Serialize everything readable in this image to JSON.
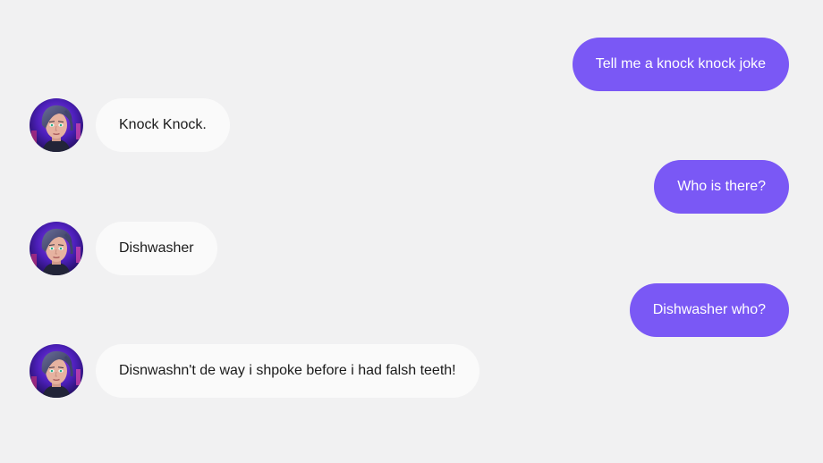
{
  "chat": {
    "messages": [
      {
        "sender": "user",
        "text": "Tell me a knock knock joke"
      },
      {
        "sender": "bot",
        "text": "Knock Knock.",
        "avatar_icon": "bot-avatar-icon"
      },
      {
        "sender": "user",
        "text": "Who is there?"
      },
      {
        "sender": "bot",
        "text": "Dishwasher",
        "avatar_icon": "bot-avatar-icon"
      },
      {
        "sender": "user",
        "text": "Dishwasher who?"
      },
      {
        "sender": "bot",
        "text": "Disnwashn't de way i shpoke before i had falsh teeth!",
        "avatar_icon": "bot-avatar-icon"
      }
    ]
  },
  "colors": {
    "background": "#f1f1f2",
    "user_bubble": "#7a58f5",
    "user_text": "#ffffff",
    "bot_bubble": "#fafafa",
    "bot_text": "#1b1b1b"
  }
}
